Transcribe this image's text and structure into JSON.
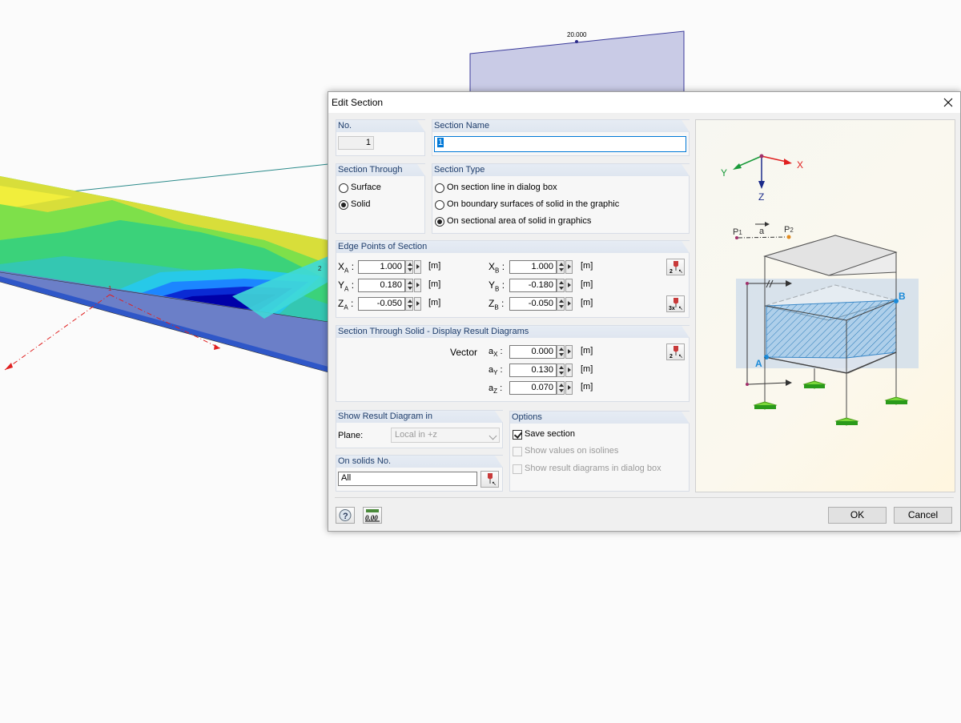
{
  "viewport": {
    "dimension_label": "20.000",
    "node_labels": [
      "1",
      "2"
    ]
  },
  "dialog": {
    "title": "Edit Section",
    "no": {
      "header": "No.",
      "value": "1"
    },
    "section_name": {
      "header": "Section Name",
      "value": "1"
    },
    "section_through": {
      "header": "Section Through",
      "options": [
        "Surface",
        "Solid"
      ],
      "selected": "Solid"
    },
    "section_type": {
      "header": "Section Type",
      "options": [
        "On section line in dialog box",
        "On boundary surfaces of solid in the graphic",
        "On sectional area of solid in graphics"
      ],
      "selected": "On sectional area of solid in graphics"
    },
    "edge_points": {
      "header": "Edge Points of Section",
      "unit": "[m]",
      "xa": {
        "label": "X",
        "sub": "A",
        "value": "1.000"
      },
      "ya": {
        "label": "Y",
        "sub": "A",
        "value": "0.180"
      },
      "za": {
        "label": "Z",
        "sub": "A",
        "value": "-0.050"
      },
      "xb": {
        "label": "X",
        "sub": "B",
        "value": "1.000"
      },
      "yb": {
        "label": "Y",
        "sub": "B",
        "value": "-0.180"
      },
      "zb": {
        "label": "Z",
        "sub": "B",
        "value": "-0.050"
      }
    },
    "display_result": {
      "header": "Section Through Solid - Display Result Diagrams",
      "vector_label": "Vector",
      "unit": "[m]",
      "ax": {
        "label": "a",
        "sub": "X",
        "value": "0.000"
      },
      "ay": {
        "label": "a",
        "sub": "Y",
        "value": "0.130"
      },
      "az": {
        "label": "a",
        "sub": "Z",
        "value": "0.070"
      }
    },
    "show_result": {
      "header": "Show Result Diagram in",
      "plane_label": "Plane:",
      "plane_value": "Local in +z"
    },
    "on_solids": {
      "header": "On solids No.",
      "value": "All"
    },
    "options": {
      "header": "Options",
      "save_section": {
        "label": "Save section",
        "checked": true
      },
      "show_values": {
        "label": "Show values on isolines",
        "checked": false
      },
      "show_diagrams": {
        "label": "Show result diagrams in dialog box",
        "checked": false
      }
    },
    "preview": {
      "axis_x": "X",
      "axis_y": "Y",
      "axis_z": "Z",
      "p1": "P",
      "p1_sub": "1",
      "p2": "P",
      "p2_sub": "2",
      "a_label": "a",
      "point_a": "A",
      "point_b": "B"
    },
    "buttons": {
      "ok": "OK",
      "cancel": "Cancel",
      "decimals": "0.00"
    }
  }
}
